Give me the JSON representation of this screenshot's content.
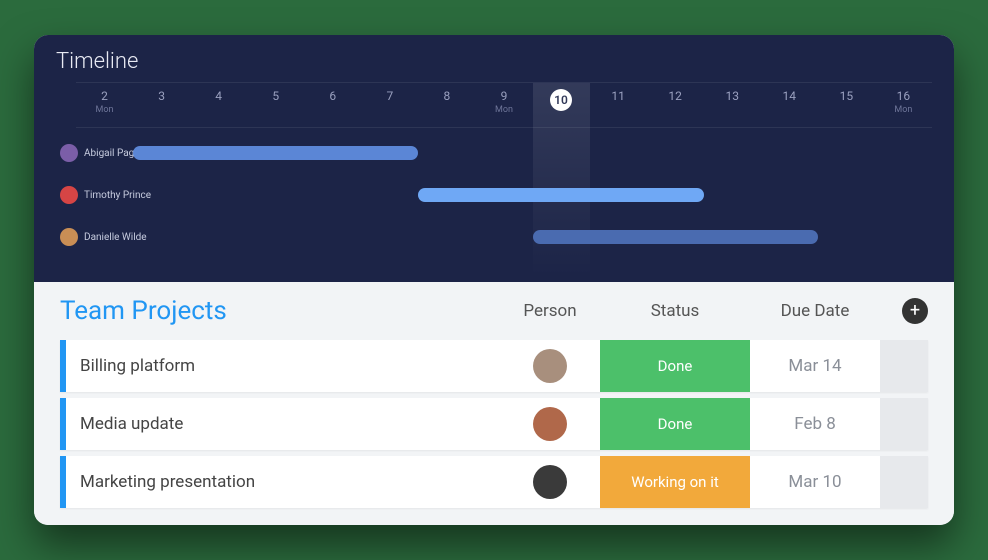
{
  "timeline": {
    "title": "Timeline",
    "dates": [
      {
        "num": "2",
        "dow": "Mon"
      },
      {
        "num": "3",
        "dow": ""
      },
      {
        "num": "4",
        "dow": ""
      },
      {
        "num": "5",
        "dow": ""
      },
      {
        "num": "6",
        "dow": ""
      },
      {
        "num": "7",
        "dow": ""
      },
      {
        "num": "8",
        "dow": ""
      },
      {
        "num": "9",
        "dow": "Mon"
      },
      {
        "num": "10",
        "dow": ""
      },
      {
        "num": "11",
        "dow": ""
      },
      {
        "num": "12",
        "dow": ""
      },
      {
        "num": "13",
        "dow": ""
      },
      {
        "num": "14",
        "dow": ""
      },
      {
        "num": "15",
        "dow": ""
      },
      {
        "num": "16",
        "dow": "Mon"
      }
    ],
    "today_index": 8,
    "rows": [
      {
        "name": "Abigail Pagi",
        "avatar_bg": "#7b5ea8",
        "bar_start": 1,
        "bar_span": 5,
        "bar_color": "#5b86d6"
      },
      {
        "name": "Timothy Prince",
        "avatar_bg": "#d64545",
        "bar_start": 6,
        "bar_span": 5,
        "bar_color": "#6fa8f5"
      },
      {
        "name": "Danielle Wilde",
        "avatar_bg": "#c98e55",
        "bar_start": 8,
        "bar_span": 5,
        "bar_color": "#4a6bb0"
      }
    ]
  },
  "projects": {
    "title": "Team Projects",
    "columns": {
      "person": "Person",
      "status": "Status",
      "due": "Due Date"
    },
    "add_icon": "+",
    "tasks": [
      {
        "name": "Billing platform",
        "avatar_bg": "#a88f7d",
        "status": "Done",
        "status_bg": "#4cc06a",
        "due": "Mar 14"
      },
      {
        "name": "Media update",
        "avatar_bg": "#b0684a",
        "status": "Done",
        "status_bg": "#4cc06a",
        "due": "Feb 8"
      },
      {
        "name": "Marketing presentation",
        "avatar_bg": "#3a3a3a",
        "status": "Working on it",
        "status_bg": "#f2a93b",
        "due": "Mar 10"
      }
    ]
  },
  "colors": {
    "accent": "#2196f3",
    "timeline_bg": "#1c2447"
  }
}
